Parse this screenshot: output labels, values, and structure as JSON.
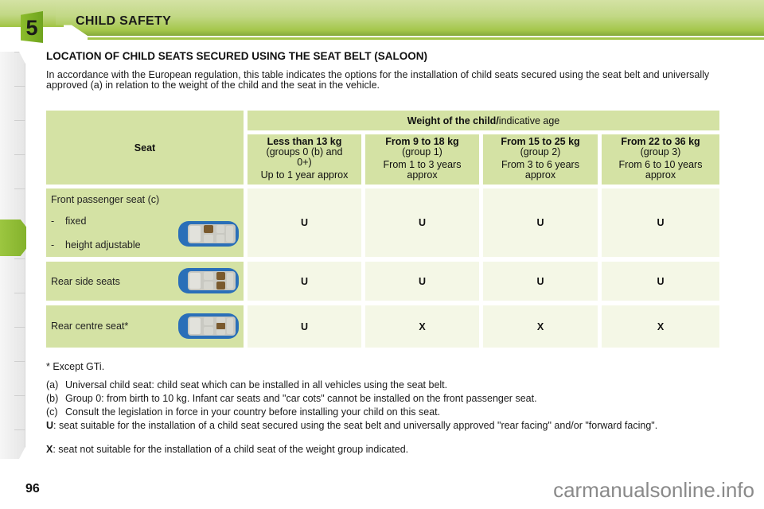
{
  "header": {
    "chapter_number": "5",
    "chapter_title": "CHILD SAFETY",
    "accent_color": "#a4c64a"
  },
  "section": {
    "title": "LOCATION OF CHILD SEATS SECURED USING THE SEAT BELT (SALOON)",
    "intro": "In accordance with the European regulation, this table indicates the options for the installation of child seats secured using the seat belt and universally approved (a) in relation to the weight of the child and the seat in the vehicle."
  },
  "table": {
    "seat_header": "Seat",
    "weight_header_bold": "Weight of the child/",
    "weight_header_rest": "indicative age",
    "groups": [
      {
        "title": "Less than 13 kg",
        "sub": "(groups 0 (b) and 0+)",
        "age": "Up to 1 year approx"
      },
      {
        "title": "From 9 to 18 kg",
        "sub": "(group 1)",
        "age": "From 1 to 3 years approx"
      },
      {
        "title": "From 15 to 25 kg",
        "sub": "(group 2)",
        "age": "From 3 to 6 years approx"
      },
      {
        "title": "From 22 to 36 kg",
        "sub": "(group 3)",
        "age": "From 6 to 10 years approx"
      }
    ],
    "rows": [
      {
        "label": "Front passenger seat (c)",
        "sub_items": [
          "-    fixed",
          "-    height adjustable"
        ],
        "icon": "car-front-passenger-seat-icon",
        "values": [
          "U",
          "U",
          "U",
          "U"
        ]
      },
      {
        "label": "Rear side seats",
        "icon": "car-rear-side-seats-icon",
        "values": [
          "U",
          "U",
          "U",
          "U"
        ]
      },
      {
        "label": "Rear centre seat*",
        "icon": "car-rear-centre-seat-icon",
        "values": [
          "U",
          "X",
          "X",
          "X"
        ]
      }
    ]
  },
  "notes": {
    "asterisk": "* Except GTi.",
    "items": [
      {
        "key": "(a)",
        "text": "Universal child seat: child seat which can be installed in all vehicles using the seat belt."
      },
      {
        "key": "(b)",
        "text": "Group 0: from birth to 10 kg. Infant car seats and \"car cots\" cannot be installed on the front passenger seat."
      },
      {
        "key": "(c)",
        "text": "Consult the legislation in force in your country before installing your child on this seat."
      },
      {
        "key": "U",
        "text": ":  seat suitable for the installation of a child seat secured using the seat belt and universally approved \"rear facing\" and/or \"forward facing\"."
      },
      {
        "key": "X",
        "text": ":  seat not suitable for the installation of a child seat of the weight group indicated."
      }
    ]
  },
  "footer": {
    "page_number": "96",
    "watermark": "carmanualsonline.info"
  }
}
